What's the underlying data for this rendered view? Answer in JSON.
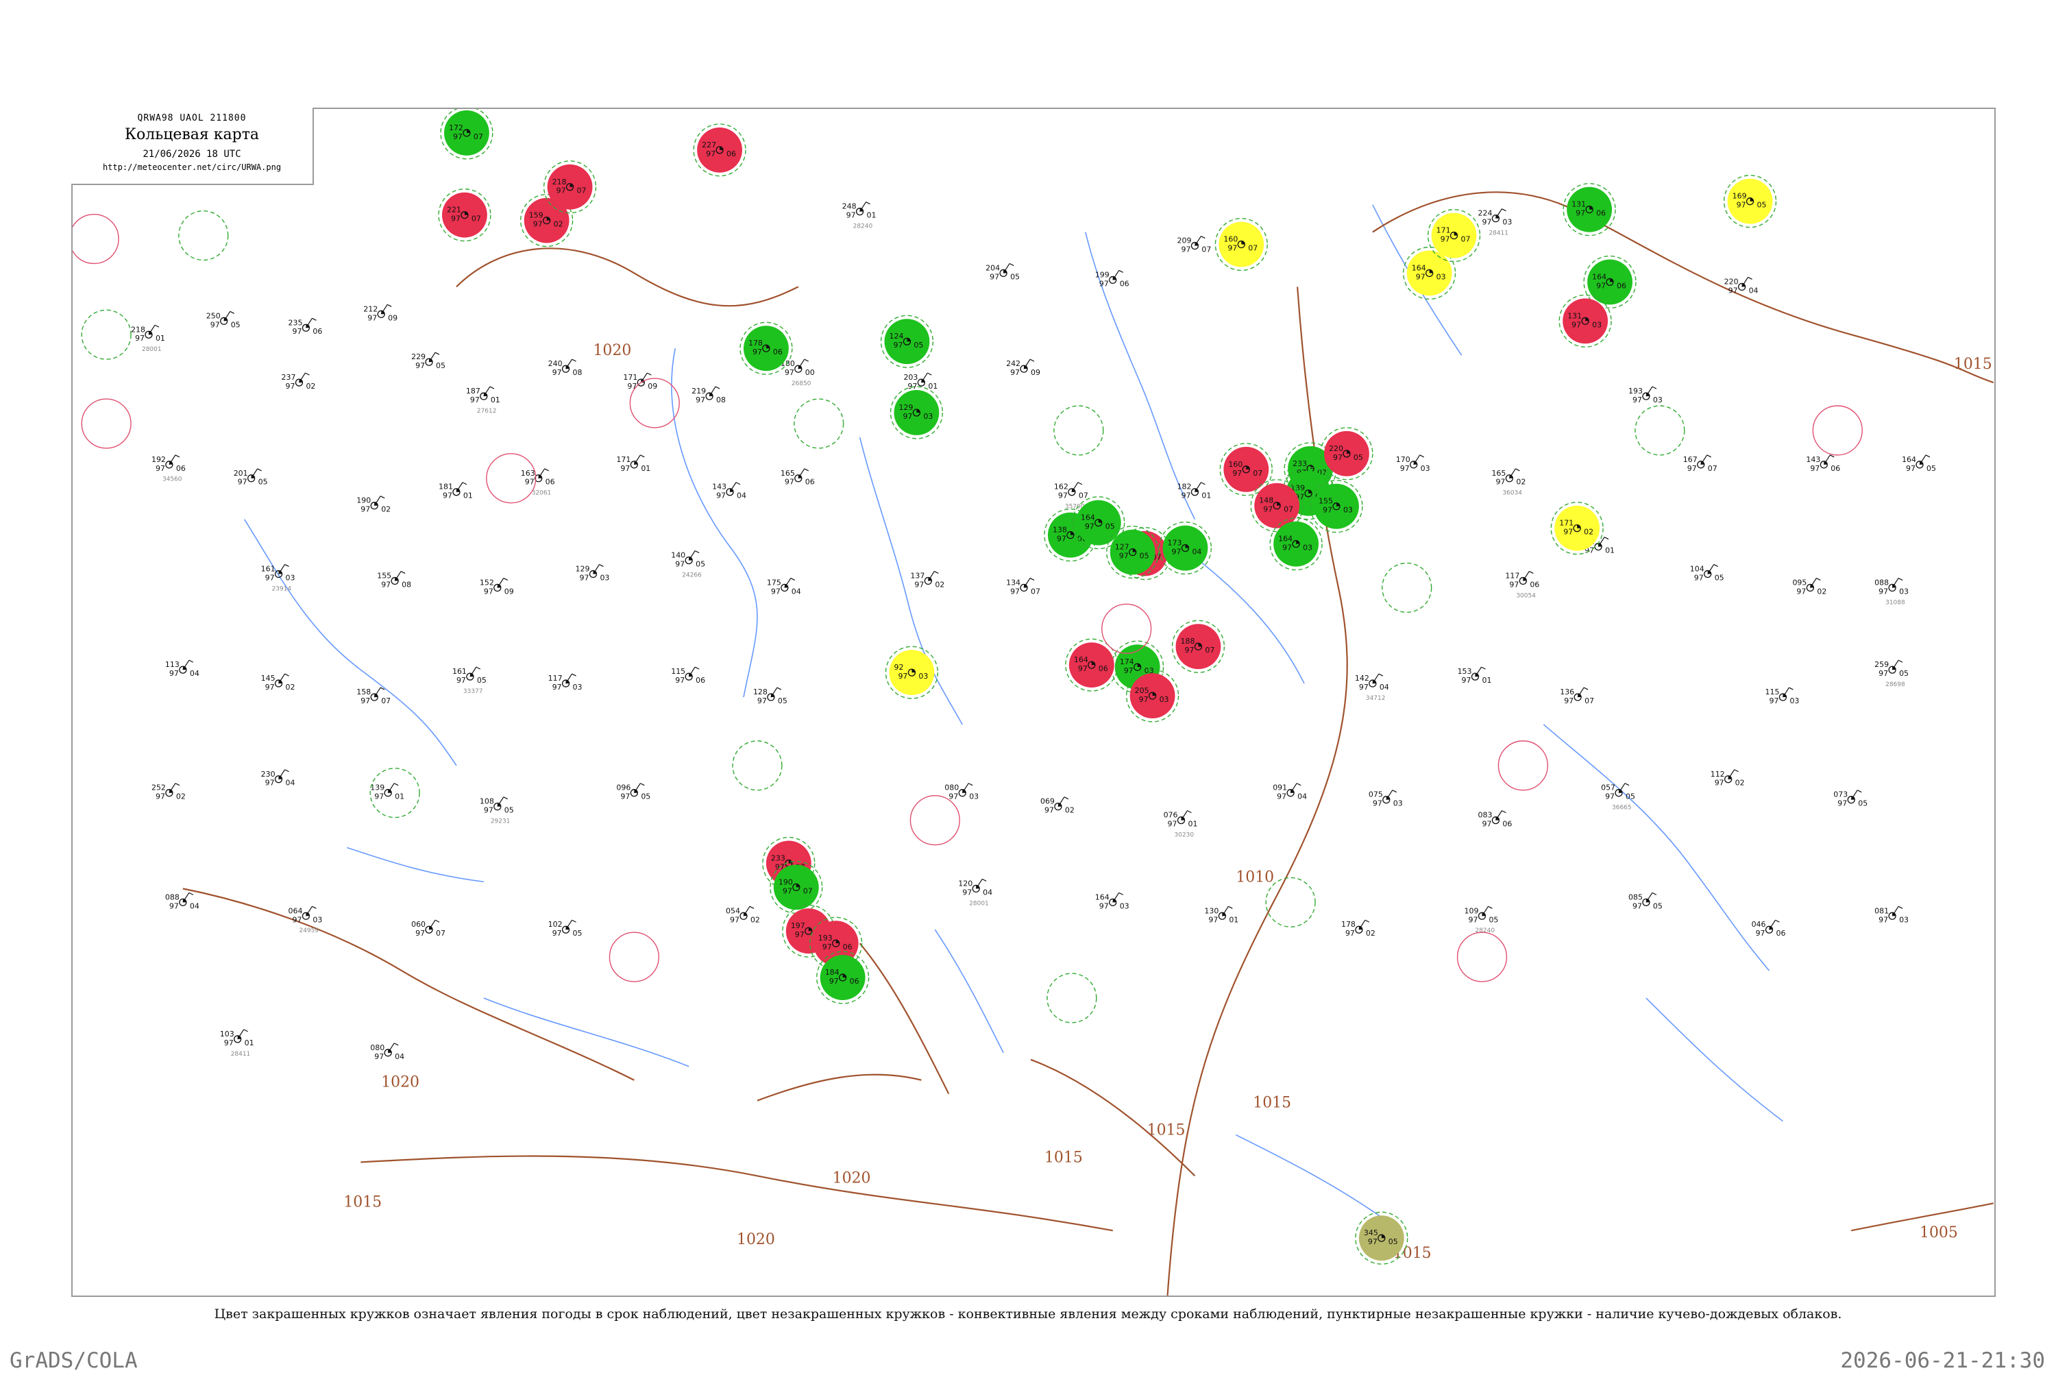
{
  "title_box": {
    "code": "QRWA98  UAOL  211800",
    "title": "Кольцевая карта",
    "date": "21/06/2026 18 UTC",
    "url": "http://meteocenter.net/circ/URWA.png"
  },
  "caption": "Цвет закрашенных кружков означает явления погоды в срок наблюдений, цвет незакрашенных кружков - конвективные явления между сроками наблюдений, пунктирные незакрашенные кружки - наличие кучево-дождевых облаков.",
  "footer": {
    "left": "GrADS/COLA",
    "right": "2026-06-21-21:30"
  },
  "colors": {
    "green_filled": "#1ec21e",
    "red_filled": "#e8304f",
    "yellow_filled": "#ffff33",
    "olive_filled": "#b8b86a",
    "red_ring": "#e05070",
    "green_dashed": "#33aa33",
    "isobar": "#a0522d",
    "river": "#6699ff",
    "frame": "#9a9a9a"
  },
  "isobars": [
    "1020",
    "1020",
    "1020",
    "1020",
    "1015",
    "1015",
    "1015",
    "1015",
    "1015",
    "1005",
    "1010",
    "1015"
  ],
  "filled_stations": [
    {
      "type": "green",
      "values": [
        "172",
        "97",
        "07"
      ]
    },
    {
      "type": "red",
      "values": [
        "221",
        "97",
        "07"
      ]
    },
    {
      "type": "red",
      "values": [
        "159",
        "97",
        "02"
      ]
    },
    {
      "type": "red",
      "values": [
        "218",
        "97",
        "07"
      ]
    },
    {
      "type": "red",
      "values": [
        "227",
        "97",
        "06"
      ]
    },
    {
      "type": "green",
      "values": [
        "178",
        "97",
        "06"
      ]
    },
    {
      "type": "green",
      "values": [
        "124",
        "97",
        "05"
      ]
    },
    {
      "type": "green",
      "values": [
        "129",
        "97",
        "03"
      ]
    },
    {
      "type": "yellow",
      "values": [
        "160",
        "97",
        "07"
      ]
    },
    {
      "type": "yellow",
      "values": [
        "164",
        "97",
        "03"
      ]
    },
    {
      "type": "yellow",
      "values": [
        "171",
        "97",
        "07"
      ]
    },
    {
      "type": "green",
      "values": [
        "131",
        "97",
        "06"
      ]
    },
    {
      "type": "green",
      "values": [
        "164",
        "97",
        "06"
      ]
    },
    {
      "type": "red",
      "values": [
        "131",
        "97",
        "03"
      ]
    },
    {
      "type": "yellow",
      "values": [
        "169",
        "97",
        "05"
      ]
    },
    {
      "type": "green",
      "values": [
        "233",
        "97",
        "07"
      ]
    },
    {
      "type": "red",
      "values": [
        "160",
        "97",
        "07"
      ]
    },
    {
      "type": "green",
      "values": [
        "139",
        "97",
        "04"
      ]
    },
    {
      "type": "red",
      "values": [
        "220",
        "97",
        "05"
      ]
    },
    {
      "type": "green",
      "values": [
        "155",
        "97",
        "03"
      ]
    },
    {
      "type": "red",
      "values": [
        "148",
        "97",
        "07"
      ]
    },
    {
      "type": "green",
      "values": [
        "164",
        "97",
        "03"
      ]
    },
    {
      "type": "green",
      "values": [
        "138",
        "97",
        "06"
      ]
    },
    {
      "type": "green",
      "values": [
        "164",
        "97",
        "05"
      ]
    },
    {
      "type": "red",
      "values": [
        "166",
        "97",
        "07"
      ]
    },
    {
      "type": "green",
      "values": [
        "127",
        "97",
        "05"
      ]
    },
    {
      "type": "green",
      "values": [
        "173",
        "97",
        "04"
      ]
    },
    {
      "type": "red",
      "values": [
        "188",
        "97",
        "07"
      ]
    },
    {
      "type": "green",
      "values": [
        "174",
        "97",
        "03"
      ]
    },
    {
      "type": "red",
      "values": [
        "164",
        "97",
        "06"
      ]
    },
    {
      "type": "red",
      "values": [
        "205",
        "97",
        "03"
      ]
    },
    {
      "type": "red",
      "values": [
        "233",
        "97",
        "07"
      ]
    },
    {
      "type": "green",
      "values": [
        "190",
        "97",
        "07"
      ]
    },
    {
      "type": "red",
      "values": [
        "197",
        "97",
        "07"
      ]
    },
    {
      "type": "red",
      "values": [
        "193",
        "97",
        "06"
      ]
    },
    {
      "type": "green",
      "values": [
        "184",
        "97",
        "06"
      ]
    },
    {
      "type": "yellow",
      "values": [
        "92",
        "97",
        "03"
      ]
    },
    {
      "type": "yellow",
      "values": [
        "171",
        "97",
        "02"
      ]
    },
    {
      "type": "olive",
      "values": [
        "345",
        "97",
        "05"
      ]
    }
  ],
  "station_readings": [
    [
      "218",
      "97",
      "01"
    ],
    [
      "250",
      "97",
      "05"
    ],
    [
      "235",
      "97",
      "06"
    ],
    [
      "212",
      "97",
      "09"
    ],
    [
      "248",
      "97",
      "01"
    ],
    [
      "204",
      "97",
      "05"
    ],
    [
      "199",
      "97",
      "06"
    ],
    [
      "209",
      "97",
      "07"
    ],
    [
      "224",
      "97",
      "03"
    ],
    [
      "220",
      "97",
      "04"
    ],
    [
      "237",
      "97",
      "02"
    ],
    [
      "229",
      "97",
      "05"
    ],
    [
      "187",
      "97",
      "01"
    ],
    [
      "240",
      "97",
      "08"
    ],
    [
      "171",
      "97",
      "09"
    ],
    [
      "219",
      "97",
      "08"
    ],
    [
      "180",
      "97",
      "00"
    ],
    [
      "203",
      "97",
      "01"
    ],
    [
      "242",
      "97",
      "09"
    ],
    [
      "193",
      "97",
      "03"
    ],
    [
      "192",
      "97",
      "06"
    ],
    [
      "201",
      "97",
      "05"
    ],
    [
      "190",
      "97",
      "02"
    ],
    [
      "181",
      "97",
      "01"
    ],
    [
      "163",
      "97",
      "06"
    ],
    [
      "171",
      "97",
      "01"
    ],
    [
      "143",
      "97",
      "04"
    ],
    [
      "165",
      "97",
      "06"
    ],
    [
      "162",
      "97",
      "07"
    ],
    [
      "182",
      "97",
      "01"
    ],
    [
      "173",
      "97",
      "05"
    ],
    [
      "170",
      "97",
      "03"
    ],
    [
      "165",
      "97",
      "02"
    ],
    [
      "167",
      "97",
      "07"
    ],
    [
      "143",
      "97",
      "06"
    ],
    [
      "164",
      "97",
      "05"
    ],
    [
      "161",
      "97",
      "03"
    ],
    [
      "155",
      "97",
      "08"
    ],
    [
      "152",
      "97",
      "09"
    ],
    [
      "129",
      "97",
      "03"
    ],
    [
      "140",
      "97",
      "05"
    ],
    [
      "175",
      "97",
      "04"
    ],
    [
      "137",
      "97",
      "02"
    ],
    [
      "134",
      "97",
      "07"
    ],
    [
      "117",
      "97",
      "06"
    ],
    [
      "112",
      "97",
      "01"
    ],
    [
      "104",
      "97",
      "05"
    ],
    [
      "095",
      "97",
      "02"
    ],
    [
      "088",
      "97",
      "03"
    ],
    [
      "113",
      "97",
      "04"
    ],
    [
      "145",
      "97",
      "02"
    ],
    [
      "158",
      "97",
      "07"
    ],
    [
      "161",
      "97",
      "05"
    ],
    [
      "117",
      "97",
      "03"
    ],
    [
      "115",
      "97",
      "06"
    ],
    [
      "128",
      "97",
      "05"
    ],
    [
      "142",
      "97",
      "04"
    ],
    [
      "153",
      "97",
      "01"
    ],
    [
      "136",
      "97",
      "07"
    ],
    [
      "115",
      "97",
      "03"
    ],
    [
      "259",
      "97",
      "05"
    ],
    [
      "252",
      "97",
      "02"
    ],
    [
      "230",
      "97",
      "04"
    ],
    [
      "139",
      "97",
      "01"
    ],
    [
      "108",
      "97",
      "05"
    ],
    [
      "096",
      "97",
      "05"
    ],
    [
      "080",
      "97",
      "03"
    ],
    [
      "069",
      "97",
      "02"
    ],
    [
      "076",
      "97",
      "01"
    ],
    [
      "091",
      "97",
      "04"
    ],
    [
      "075",
      "97",
      "03"
    ],
    [
      "083",
      "97",
      "06"
    ],
    [
      "057",
      "97",
      "05"
    ],
    [
      "112",
      "97",
      "02"
    ],
    [
      "073",
      "97",
      "05"
    ],
    [
      "088",
      "97",
      "04"
    ],
    [
      "064",
      "97",
      "03"
    ],
    [
      "060",
      "97",
      "07"
    ],
    [
      "102",
      "97",
      "05"
    ],
    [
      "054",
      "97",
      "02"
    ],
    [
      "120",
      "97",
      "04"
    ],
    [
      "164",
      "97",
      "03"
    ],
    [
      "130",
      "97",
      "01"
    ],
    [
      "178",
      "97",
      "02"
    ],
    [
      "109",
      "97",
      "05"
    ],
    [
      "085",
      "97",
      "05"
    ],
    [
      "046",
      "97",
      "06"
    ],
    [
      "081",
      "97",
      "03"
    ],
    [
      "103",
      "97",
      "01"
    ],
    [
      "080",
      "97",
      "04"
    ]
  ],
  "station_indices": [
    "28001",
    "28240",
    "28411",
    "27612",
    "26850",
    "34560",
    "32061",
    "35700",
    "36034",
    "23914",
    "24266",
    "30054",
    "31088",
    "33377",
    "34712",
    "28698",
    "29231",
    "30230",
    "36665",
    "24959"
  ]
}
